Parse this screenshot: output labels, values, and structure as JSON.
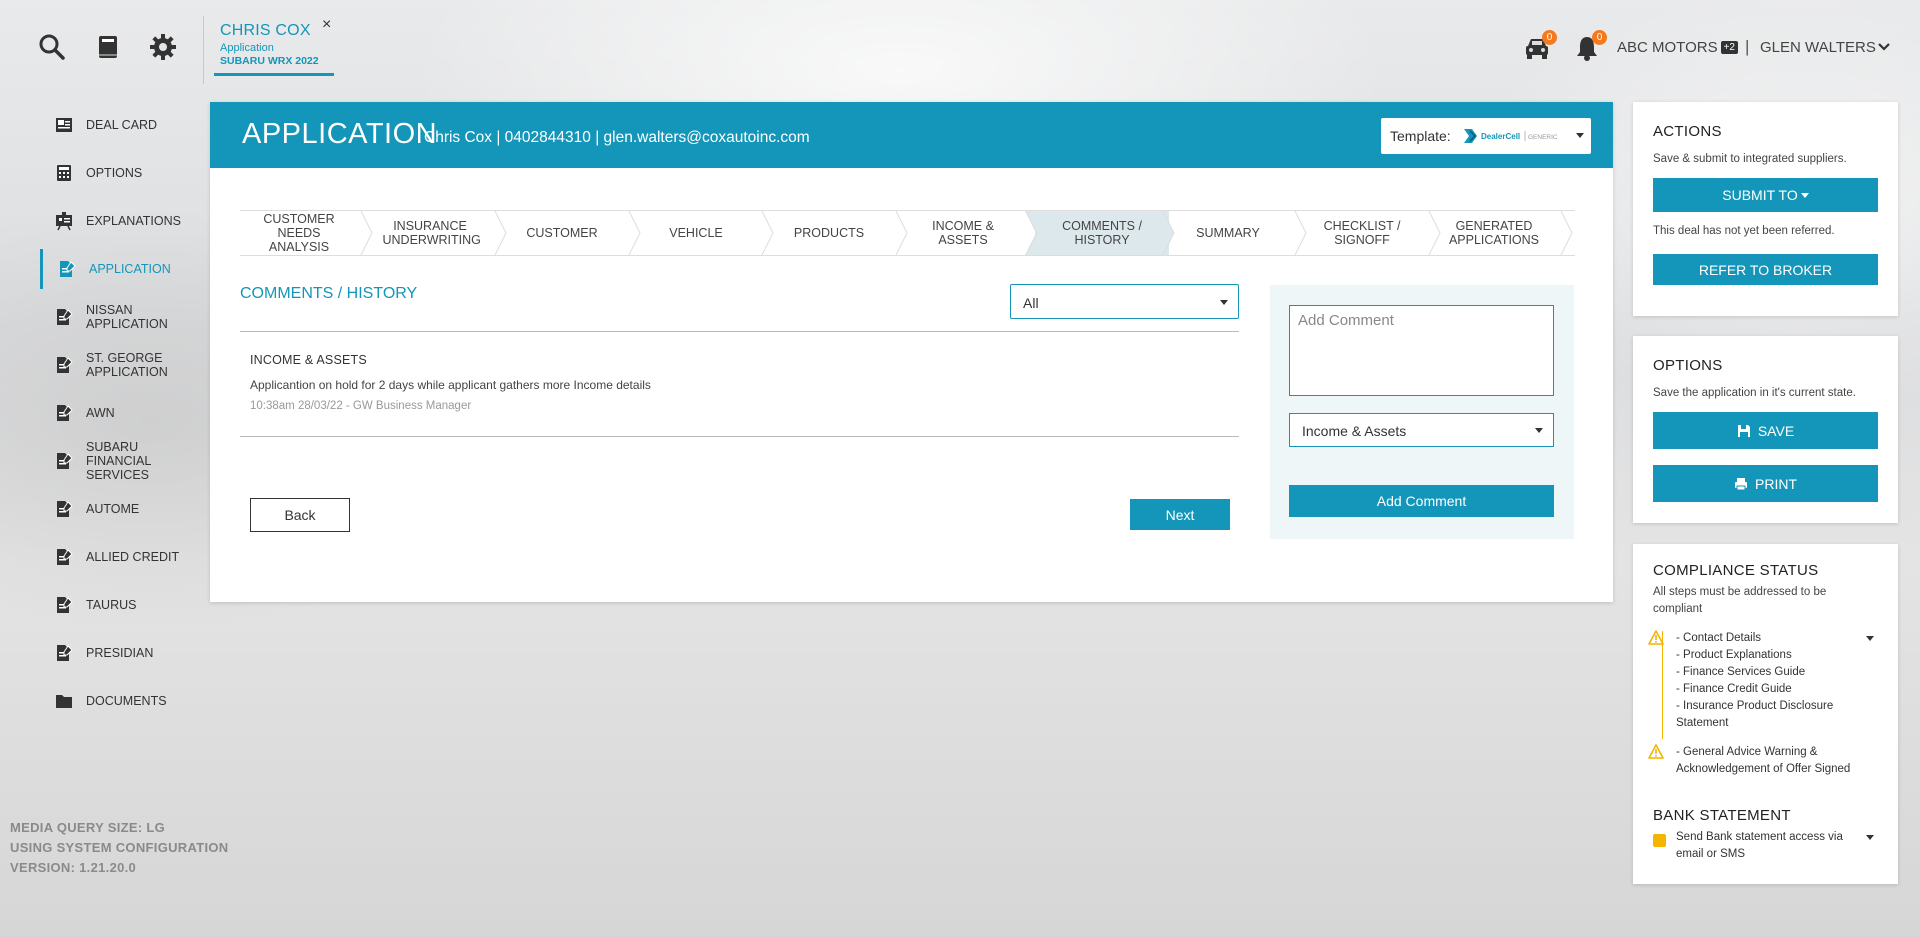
{
  "header": {
    "search_icon": "search-icon",
    "book_icon": "book-icon",
    "settings_icon": "gear-icon",
    "deal_tab": {
      "name": "CHRIS COX",
      "subtitle": "Application",
      "vehicle": "SUBARU WRX 2022",
      "close_label": "×"
    },
    "cart_badge": "0",
    "notification_badge": "0",
    "dealer": "ABC MOTORS",
    "dealer_extra": "+2",
    "separator": "|",
    "user": "GLEN WALTERS"
  },
  "sidebar": {
    "items": [
      {
        "label": "DEAL CARD",
        "icon": "deal-card-icon",
        "active": false
      },
      {
        "label": "OPTIONS",
        "icon": "calculator-icon",
        "active": false
      },
      {
        "label": "EXPLANATIONS",
        "icon": "presentation-icon",
        "active": false
      },
      {
        "label": "APPLICATION",
        "icon": "document-edit-icon",
        "active": true
      },
      {
        "label": "NISSAN APPLICATION",
        "icon": "document-edit-icon",
        "active": false
      },
      {
        "label": "ST. GEORGE APPLICATION",
        "icon": "document-edit-icon",
        "active": false
      },
      {
        "label": "AWN",
        "icon": "document-edit-icon",
        "active": false
      },
      {
        "label": "SUBARU FINANCIAL SERVICES",
        "icon": "document-edit-icon",
        "active": false
      },
      {
        "label": "AUTOME",
        "icon": "document-edit-icon",
        "active": false
      },
      {
        "label": "ALLIED CREDIT",
        "icon": "document-edit-icon",
        "active": false
      },
      {
        "label": "TAURUS",
        "icon": "document-edit-icon",
        "active": false
      },
      {
        "label": "PRESIDIAN",
        "icon": "document-edit-icon",
        "active": false
      },
      {
        "label": "DOCUMENTS",
        "icon": "folder-icon",
        "active": false
      }
    ],
    "sysinfo": [
      "MEDIA QUERY SIZE: LG",
      "USING SYSTEM CONFIGURATION",
      "VERSION: 1.21.20.0"
    ]
  },
  "main": {
    "title": "APPLICATION",
    "info": "Chris Cox | 0402844310 | glen.walters@coxautoinc.com",
    "template_label": "Template:",
    "template_logo_text": "DealerCell",
    "template_logo_sub": "GENERIC",
    "steps": [
      {
        "label": "CUSTOMER NEEDS ANALYSIS",
        "active": false
      },
      {
        "label": "INSURANCE UNDERWRITING",
        "active": false
      },
      {
        "label": "CUSTOMER",
        "active": false
      },
      {
        "label": "VEHICLE",
        "active": false
      },
      {
        "label": "PRODUCTS",
        "active": false
      },
      {
        "label": "INCOME & ASSETS",
        "active": false
      },
      {
        "label": "COMMENTS / HISTORY",
        "active": true
      },
      {
        "label": "SUMMARY",
        "active": false
      },
      {
        "label": "CHECKLIST / SIGNOFF",
        "active": false
      },
      {
        "label": "GENERATED APPLICATIONS",
        "active": false
      }
    ],
    "section_title": "COMMENTS / HISTORY",
    "filter_value": "All",
    "comments": [
      {
        "category": "INCOME & ASSETS",
        "text": "Applicantion on hold for 2 days while applicant gathers more Income details",
        "meta": "10:38am 28/03/22 - GW Business Manager"
      }
    ],
    "back_label": "Back",
    "next_label": "Next",
    "comment_placeholder": "Add Comment",
    "category_value": "Income & Assets",
    "add_comment_label": "Add Comment"
  },
  "actions": {
    "title": "ACTIONS",
    "text": "Save & submit to integrated suppliers.",
    "submit_label": "SUBMIT TO",
    "status_text": "This deal has not yet been referred.",
    "refer_label": "REFER TO BROKER"
  },
  "options": {
    "title": "OPTIONS",
    "text": "Save the application in it's current state.",
    "save_label": "SAVE",
    "print_label": "PRINT"
  },
  "compliance": {
    "title": "COMPLIANCE STATUS",
    "text": "All steps must be addressed to be compliant",
    "group1": [
      "- Contact Details",
      "- Product Explanations",
      "- Finance Services Guide",
      "- Finance Credit Guide",
      "- Insurance Product Disclosure Statement"
    ],
    "group2": "- General Advice Warning & Acknowledgement of Offer Signed"
  },
  "bank": {
    "title": "BANK STATEMENT",
    "text": "Send Bank statement access via email or SMS"
  },
  "colors": {
    "accent": "#1396b9",
    "badge": "#f47a1f",
    "warning": "#f4b400"
  }
}
